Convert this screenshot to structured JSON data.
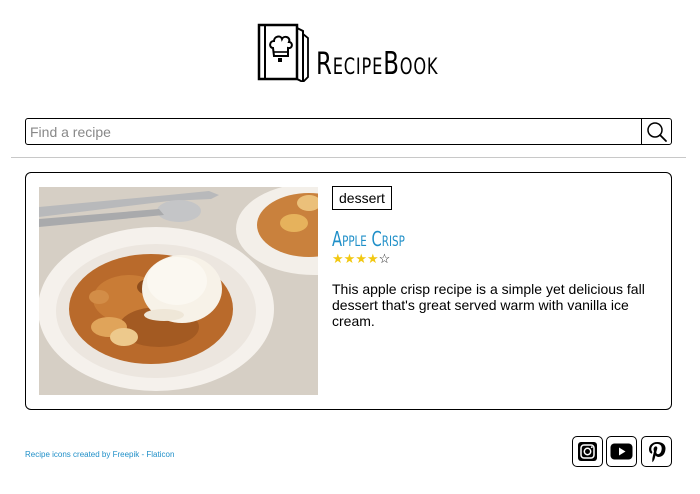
{
  "brand": {
    "name": "RecipeBook"
  },
  "search": {
    "placeholder": "Find a recipe",
    "value": ""
  },
  "recipe": {
    "tag": "dessert",
    "title": "Apple Crisp",
    "rating": 4,
    "rating_max": 5,
    "description": "This apple crisp recipe is a simple yet delicious fall dessert that's great served warm with vanilla ice cream."
  },
  "footer": {
    "credit": "Recipe icons created by Freepik - Flaticon",
    "social": [
      {
        "icon": "instagram-icon"
      },
      {
        "icon": "youtube-icon"
      },
      {
        "icon": "pinterest-icon"
      }
    ]
  },
  "colors": {
    "accent": "#1f8fc8",
    "star": "#f2c811"
  }
}
